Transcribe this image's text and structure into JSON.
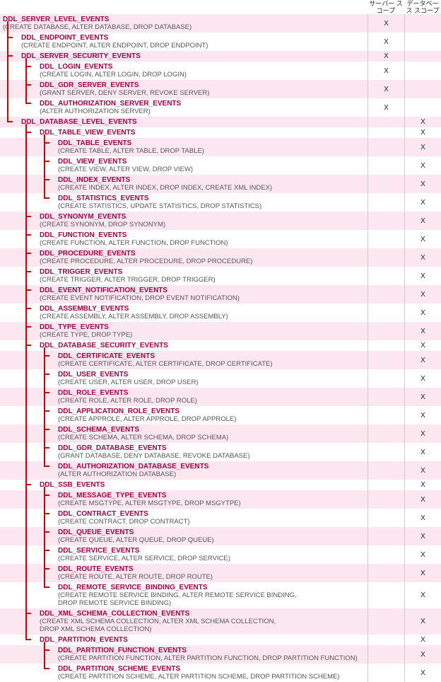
{
  "headers": {
    "col1": "サーバー\nスコープ",
    "col2": "データベース\nスコープ"
  },
  "nodes": [
    {
      "id": "n0",
      "depth": 0,
      "title": "DDL_SERVER_LEVEL_EVENTS",
      "desc": "(CREATE DATABASE, ALTER DATABASE, DROP DATABASE)",
      "scope": "s",
      "alt": true
    },
    {
      "id": "n1",
      "depth": 1,
      "title": "DDL_ENDPOINT_EVENTS",
      "desc": "(CREATE ENDPOINT, ALTER ENDPOINT, DROP ENDPOINT)",
      "scope": "s",
      "alt": false
    },
    {
      "id": "n2",
      "depth": 1,
      "title": "DDL_SERVER_SECURITY_EVENTS",
      "desc": "",
      "scope": "s",
      "alt": true
    },
    {
      "id": "n3",
      "depth": 2,
      "title": "DDL_LOGIN_EVENTS",
      "desc": "(CREATE LOGIN, ALTER LOGIN, DROP LOGIN)",
      "scope": "s",
      "alt": false
    },
    {
      "id": "n4",
      "depth": 2,
      "title": "DDL_GDR_SERVER_EVENTS",
      "desc": "(GRANT SERVER, DENY SERVER, REVOKE SERVER)",
      "scope": "s",
      "alt": true
    },
    {
      "id": "n5",
      "depth": 2,
      "title": "DDL_AUTHORIZATION_SERVER_EVENTS",
      "desc": "(ALTER AUTHORIZATION SERVER)",
      "scope": "s",
      "alt": false
    },
    {
      "id": "n6",
      "depth": 1,
      "title": "DDL_DATABASE_LEVEL_EVENTS",
      "desc": "",
      "scope": "d",
      "alt": true
    },
    {
      "id": "n7",
      "depth": 2,
      "title": "DDL_TABLE_VIEW_EVENTS",
      "desc": "",
      "scope": "d",
      "alt": false
    },
    {
      "id": "n8",
      "depth": 3,
      "title": "DDL_TABLE_EVENTS",
      "desc": "(CREATE TABLE, ALTER TABLE, DROP TABLE)",
      "scope": "d",
      "alt": true
    },
    {
      "id": "n9",
      "depth": 3,
      "title": "DDL_VIEW_EVENTS",
      "desc": "(CREATE VIEW, ALTER VIEW, DROP VIEW)",
      "scope": "d",
      "alt": false
    },
    {
      "id": "n10",
      "depth": 3,
      "title": "DDL_INDEX_EVENTS",
      "desc": "(CREATE INDEX, ALTER INDEX, DROP INDEX, CREATE XML INDEX)",
      "scope": "d",
      "alt": true
    },
    {
      "id": "n11",
      "depth": 3,
      "title": "DDL_STATISTICS_EVENTS",
      "desc": "(CREATE STATISTICS, UPDATE STATISTICS, DROP STATISTICS)",
      "scope": "d",
      "alt": false
    },
    {
      "id": "n12",
      "depth": 2,
      "title": "DDL_SYNONYM_EVENTS",
      "desc": "(CREATE SYNONYM, DROP SYNONYM)",
      "scope": "d",
      "alt": true
    },
    {
      "id": "n13",
      "depth": 2,
      "title": "DDL_FUNCTION_EVENTS",
      "desc": "(CREATE FUNCTION, ALTER FUNCTION, DROP FUNCTION)",
      "scope": "d",
      "alt": false
    },
    {
      "id": "n14",
      "depth": 2,
      "title": "DDL_PROCEDURE_EVENTS",
      "desc": "(CREATE PROCEDURE, ALTER PROCEDURE, DROP PROCEDURE)",
      "scope": "d",
      "alt": true
    },
    {
      "id": "n15",
      "depth": 2,
      "title": "DDL_TRIGGER_EVENTS",
      "desc": "(CREATE TRIGGER, ALTER TRIGGER, DROP TRIGGER)",
      "scope": "d",
      "alt": false
    },
    {
      "id": "n16",
      "depth": 2,
      "title": "DDL_EVENT_NOTIFICATION_EVENTS",
      "desc": "(CREATE EVENT NOTIFICATION, DROP EVENT NOTIFICATION)",
      "scope": "d",
      "alt": true
    },
    {
      "id": "n17",
      "depth": 2,
      "title": "DDL_ASSEMBLY_EVENTS",
      "desc": "(CREATE ASSEMBLY, ALTER ASSEMBLY, DROP ASSEMBLY)",
      "scope": "d",
      "alt": false
    },
    {
      "id": "n18",
      "depth": 2,
      "title": "DDL_TYPE_EVENTS",
      "desc": "(CREATE TYPE, DROP TYPE)",
      "scope": "d",
      "alt": true
    },
    {
      "id": "n19",
      "depth": 2,
      "title": "DDL_DATABASE_SECURITY_EVENTS",
      "desc": "",
      "scope": "d",
      "alt": false
    },
    {
      "id": "n20",
      "depth": 3,
      "title": "DDL_CERTIFICATE_EVENTS",
      "desc": "(CREATE CERTIFICATE, ALTER CERTIFICATE, DROP CERTIFICATE)",
      "scope": "d",
      "alt": true
    },
    {
      "id": "n21",
      "depth": 3,
      "title": "DDL_USER_EVENTS",
      "desc": "(CREATE USER, ALTER USER, DROP USER)",
      "scope": "d",
      "alt": false
    },
    {
      "id": "n22",
      "depth": 3,
      "title": "DDL_ROLE_EVENTS",
      "desc": "(CREATE ROLE, ALTER ROLE, DROP ROLE)",
      "scope": "d",
      "alt": true
    },
    {
      "id": "n23",
      "depth": 3,
      "title": "DDL_APPLICATION_ROLE_EVENTS",
      "desc": "(CREATE APPROLE, ALTER APPROLE, DROP APPROLE)",
      "scope": "d",
      "alt": false
    },
    {
      "id": "n24",
      "depth": 3,
      "title": "DDL_SCHEMA_EVENTS",
      "desc": "(CREATE SCHEMA, ALTER SCHEMA, DROP SCHEMA)",
      "scope": "d",
      "alt": true
    },
    {
      "id": "n25",
      "depth": 3,
      "title": "DDL_GDR_DATABASE_EVENTS",
      "desc": "(GRANT DATABASE, DENY DATABASE, REVOKE DATABASE)",
      "scope": "d",
      "alt": false
    },
    {
      "id": "n26",
      "depth": 3,
      "title": "DDL_AUTHORIZATION_DATABASE_EVENTS",
      "desc": "(ALTER AUTHORIZATION DATABASE)",
      "scope": "d",
      "alt": true
    },
    {
      "id": "n27",
      "depth": 2,
      "title": "DDL_SSB_EVENTS",
      "desc": "",
      "scope": "d",
      "alt": false
    },
    {
      "id": "n28",
      "depth": 3,
      "title": "DDL_MESSAGE_TYPE_EVENTS",
      "desc": "(CREATE MSGTYPE, ALTER MSGTYPE, DROP MSGYTPE)",
      "scope": "d",
      "alt": true
    },
    {
      "id": "n29",
      "depth": 3,
      "title": "DDL_CONTRACT_EVENTS",
      "desc": "(CREATE CONTRACT, DROP CONTRACT)",
      "scope": "d",
      "alt": false
    },
    {
      "id": "n30",
      "depth": 3,
      "title": "DDL_QUEUE_EVENTS",
      "desc": "(CREATE QUEUE, ALTER QUEUE, DROP QUEUE)",
      "scope": "d",
      "alt": true
    },
    {
      "id": "n31",
      "depth": 3,
      "title": "DDL_SERVICE_EVENTS",
      "desc": "(CREATE SERVICE, ALTER SERVICE, DROP SERVICE)",
      "scope": "d",
      "alt": false
    },
    {
      "id": "n32",
      "depth": 3,
      "title": "DDL_ROUTE_EVENTS",
      "desc": "(CREATE ROUTE, ALTER ROUTE, DROP ROUTE)",
      "scope": "d",
      "alt": true
    },
    {
      "id": "n33",
      "depth": 3,
      "title": "DDL_REMOTE_SERVICE_BINDING_EVENTS",
      "desc": "(CREATE REMOTE SERVICE BINDING, ALTER REMOTE SERVICE BINDING,\n DROP REMOTE SERVICE BINDING)",
      "scope": "d",
      "alt": false
    },
    {
      "id": "n34",
      "depth": 2,
      "title": "DDL_XML_SCHEMA_COLLECTION_EVENTS",
      "desc": "(CREATE XML SCHEMA COLLECTION, ALTER XML SCHEMA COLLECTION,\n DROP XML SCHEMA COLLECTION)",
      "scope": "d",
      "alt": true
    },
    {
      "id": "n35",
      "depth": 2,
      "title": "DDL_PARTITION_EVENTS",
      "desc": "",
      "scope": "d",
      "alt": false
    },
    {
      "id": "n36",
      "depth": 3,
      "title": "DDL_PARTITION_FUNCTION_EVENTS",
      "desc": "(CREATE PARTITION FUNCTION, ALTER PARTITION FUNCTION, DROP PARTITION FUNCTION)",
      "scope": "d",
      "alt": true
    },
    {
      "id": "n37",
      "depth": 3,
      "title": "DDL_PARTITION_SCHEME_EVENTS",
      "desc": "(CREATE PARTITION SCHEME, ALTER PARTITION SCHEME, DROP PARTITION SCHEME)",
      "scope": "d",
      "alt": false
    }
  ]
}
